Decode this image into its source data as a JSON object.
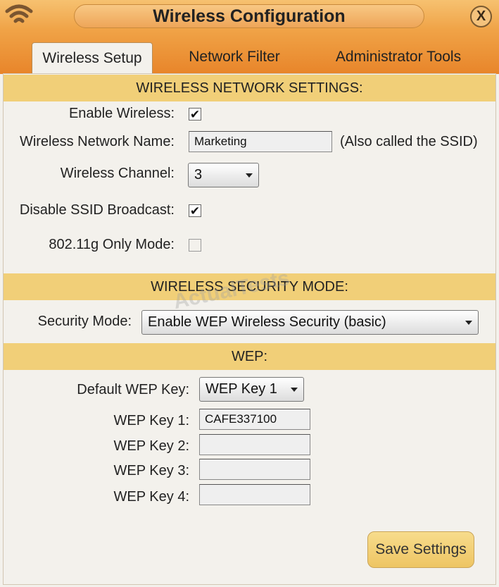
{
  "window": {
    "title": "Wireless Configuration",
    "close_label": "X"
  },
  "tabs": [
    {
      "label": "Wireless Setup",
      "active": true
    },
    {
      "label": "Network Filter",
      "active": false
    },
    {
      "label": "Administrator Tools",
      "active": false
    }
  ],
  "network_settings": {
    "header": "WIRELESS NETWORK SETTINGS:",
    "enable_wireless_label": "Enable Wireless:",
    "enable_wireless_checked": true,
    "network_name_label": "Wireless Network Name:",
    "network_name_value": "Marketing",
    "network_name_hint": "(Also called the SSID)",
    "channel_label": "Wireless Channel:",
    "channel_value": "3",
    "disable_ssid_label": "Disable SSID Broadcast:",
    "disable_ssid_checked": true,
    "g_only_label": "802.11g Only Mode:",
    "g_only_checked": false
  },
  "security": {
    "header": "WIRELESS SECURITY MODE:",
    "mode_label": "Security Mode:",
    "mode_value": "Enable WEP Wireless Security (basic)"
  },
  "wep": {
    "header": "WEP:",
    "default_key_label": "Default WEP Key:",
    "default_key_value": "WEP Key 1",
    "keys": [
      {
        "label": "WEP Key 1:",
        "value": "CAFE337100"
      },
      {
        "label": "WEP Key 2:",
        "value": ""
      },
      {
        "label": "WEP Key 3:",
        "value": ""
      },
      {
        "label": "WEP Key 4:",
        "value": ""
      }
    ]
  },
  "actions": {
    "save_label": "Save Settings"
  },
  "watermark": "ActualTests",
  "colors": {
    "titlebar_top": "#f6c170",
    "titlebar_bottom": "#e8852a",
    "section_bar": "#f1cf78",
    "panel_bg": "#f3f1ec",
    "save_button": "#f2d078"
  },
  "icons": {
    "wifi": "wifi-icon",
    "close": "close-icon",
    "check": "checkmark-icon",
    "caret": "chevron-down-icon"
  }
}
